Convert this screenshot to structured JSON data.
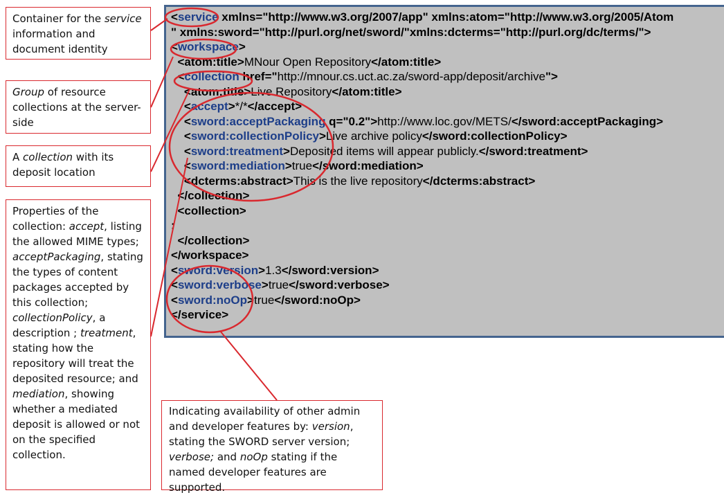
{
  "notes": {
    "service": {
      "before": "Container for the ",
      "em": "service",
      "after": " information and document identity"
    },
    "workspace": {
      "em": "Group",
      "after": " of resource collections at the server-side"
    },
    "collection": {
      "before": "A ",
      "em": "collection",
      "after": " with its deposit location"
    },
    "properties": [
      {
        "t": "Properties of the collection: "
      },
      {
        "t": "accept",
        "em": true
      },
      {
        "t": ", listing the allowed MIME types; "
      },
      {
        "t": "acceptPackaging",
        "em": true
      },
      {
        "t": ", stating the types of content packages accepted by this collection; "
      },
      {
        "t": "collectionPolicy",
        "em": true
      },
      {
        "t": ", a description ; "
      },
      {
        "t": "treatment",
        "em": true
      },
      {
        "t": ", stating how the repository will treat the deposited resource; and "
      },
      {
        "t": "mediation",
        "em": true
      },
      {
        "t": ", showing whether a mediated deposit is allowed or not on the specified collection."
      }
    ],
    "admin": [
      {
        "t": "Indicating availability of other admin and developer features by: "
      },
      {
        "t": "version",
        "em": true
      },
      {
        "t": ", stating the SWORD server version; "
      },
      {
        "t": "verbose;",
        "em": true
      },
      {
        "t": " and "
      },
      {
        "t": "noOp",
        "em": true
      },
      {
        "t": " stating if the named developer features are supported."
      }
    ]
  },
  "xml_lines": [
    [
      {
        "t": "<"
      },
      {
        "t": "service",
        "c": "t"
      },
      {
        "t": " xmlns=\"http://www.w3.org/2007/app\" xmlns:atom=\"http://www.w3.org/2005/Atom"
      }
    ],
    [
      {
        "t": "\" xmlns:sword=\"http://purl.org/net/sword/\"xmlns:dcterms=\"http://purl.org/dc/terms/\">"
      }
    ],
    [
      {
        "t": "<"
      },
      {
        "t": "workspace",
        "c": "t"
      },
      {
        "t": ">"
      }
    ],
    [
      {
        "t": "  <atom:title>"
      },
      {
        "t": "MNour Open Repository",
        "c": "v"
      },
      {
        "t": "</atom:title>"
      }
    ],
    [
      {
        "t": "  <"
      },
      {
        "t": "collection",
        "c": "t"
      },
      {
        "t": " href=\""
      },
      {
        "t": "http://mnour.cs.uct.ac.za/sword-app/deposit/archive",
        "c": "v"
      },
      {
        "t": "\">"
      }
    ],
    [
      {
        "t": "    <atom:title>"
      },
      {
        "t": "Live Repository",
        "c": "v"
      },
      {
        "t": "</atom:title>"
      }
    ],
    [
      {
        "t": "    <"
      },
      {
        "t": "accept",
        "c": "t"
      },
      {
        "t": ">"
      },
      {
        "t": "*/*",
        "c": "v"
      },
      {
        "t": "</accept>"
      }
    ],
    [
      {
        "t": "    <"
      },
      {
        "t": "sword:acceptPackaging",
        "c": "t"
      },
      {
        "t": " q=\"0.2\">"
      },
      {
        "t": "http://www.loc.gov/METS/",
        "c": "v"
      },
      {
        "t": "</sword:acceptPackaging>"
      }
    ],
    [
      {
        "t": "    <"
      },
      {
        "t": "sword:collectionPolicy",
        "c": "t"
      },
      {
        "t": ">"
      },
      {
        "t": "Live archive policy",
        "c": "v"
      },
      {
        "t": "</sword:collectionPolicy>"
      }
    ],
    [
      {
        "t": "    <"
      },
      {
        "t": "sword:treatment",
        "c": "t"
      },
      {
        "t": ">"
      },
      {
        "t": "Deposited items will appear publicly.",
        "c": "v"
      },
      {
        "t": "</sword:treatment>"
      }
    ],
    [
      {
        "t": "    <"
      },
      {
        "t": "sword:mediation",
        "c": "t"
      },
      {
        "t": ">"
      },
      {
        "t": "true",
        "c": "v"
      },
      {
        "t": "</sword:mediation>"
      }
    ],
    [
      {
        "t": "    <dcterms:abstract>"
      },
      {
        "t": "This is the live repository",
        "c": "v"
      },
      {
        "t": "</dcterms:abstract>"
      }
    ],
    [
      {
        "t": "  </collection>"
      }
    ],
    [
      {
        "t": "  <collection>"
      }
    ],
    [
      {
        "t": ":"
      }
    ],
    [
      {
        "t": "  </collection>"
      }
    ],
    [
      {
        "t": "</workspace>"
      }
    ],
    [
      {
        "t": "<"
      },
      {
        "t": "sword:version",
        "c": "t"
      },
      {
        "t": ">"
      },
      {
        "t": "1.3",
        "c": "v"
      },
      {
        "t": "</sword:version>"
      }
    ],
    [
      {
        "t": "<"
      },
      {
        "t": "sword:verbose",
        "c": "t"
      },
      {
        "t": ">"
      },
      {
        "t": "true",
        "c": "v"
      },
      {
        "t": "</sword:verbose>"
      }
    ],
    [
      {
        "t": "<"
      },
      {
        "t": "sword:noOp",
        "c": "t"
      },
      {
        "t": ">"
      },
      {
        "t": "true",
        "c": "v"
      },
      {
        "t": "</sword:noOp>"
      }
    ],
    [
      {
        "t": "</service>"
      }
    ]
  ],
  "colors": {
    "annotation": "#d9282e",
    "tag_highlight": "#1d3e89",
    "code_bg": "#c0c0c0",
    "code_border": "#44648e"
  }
}
